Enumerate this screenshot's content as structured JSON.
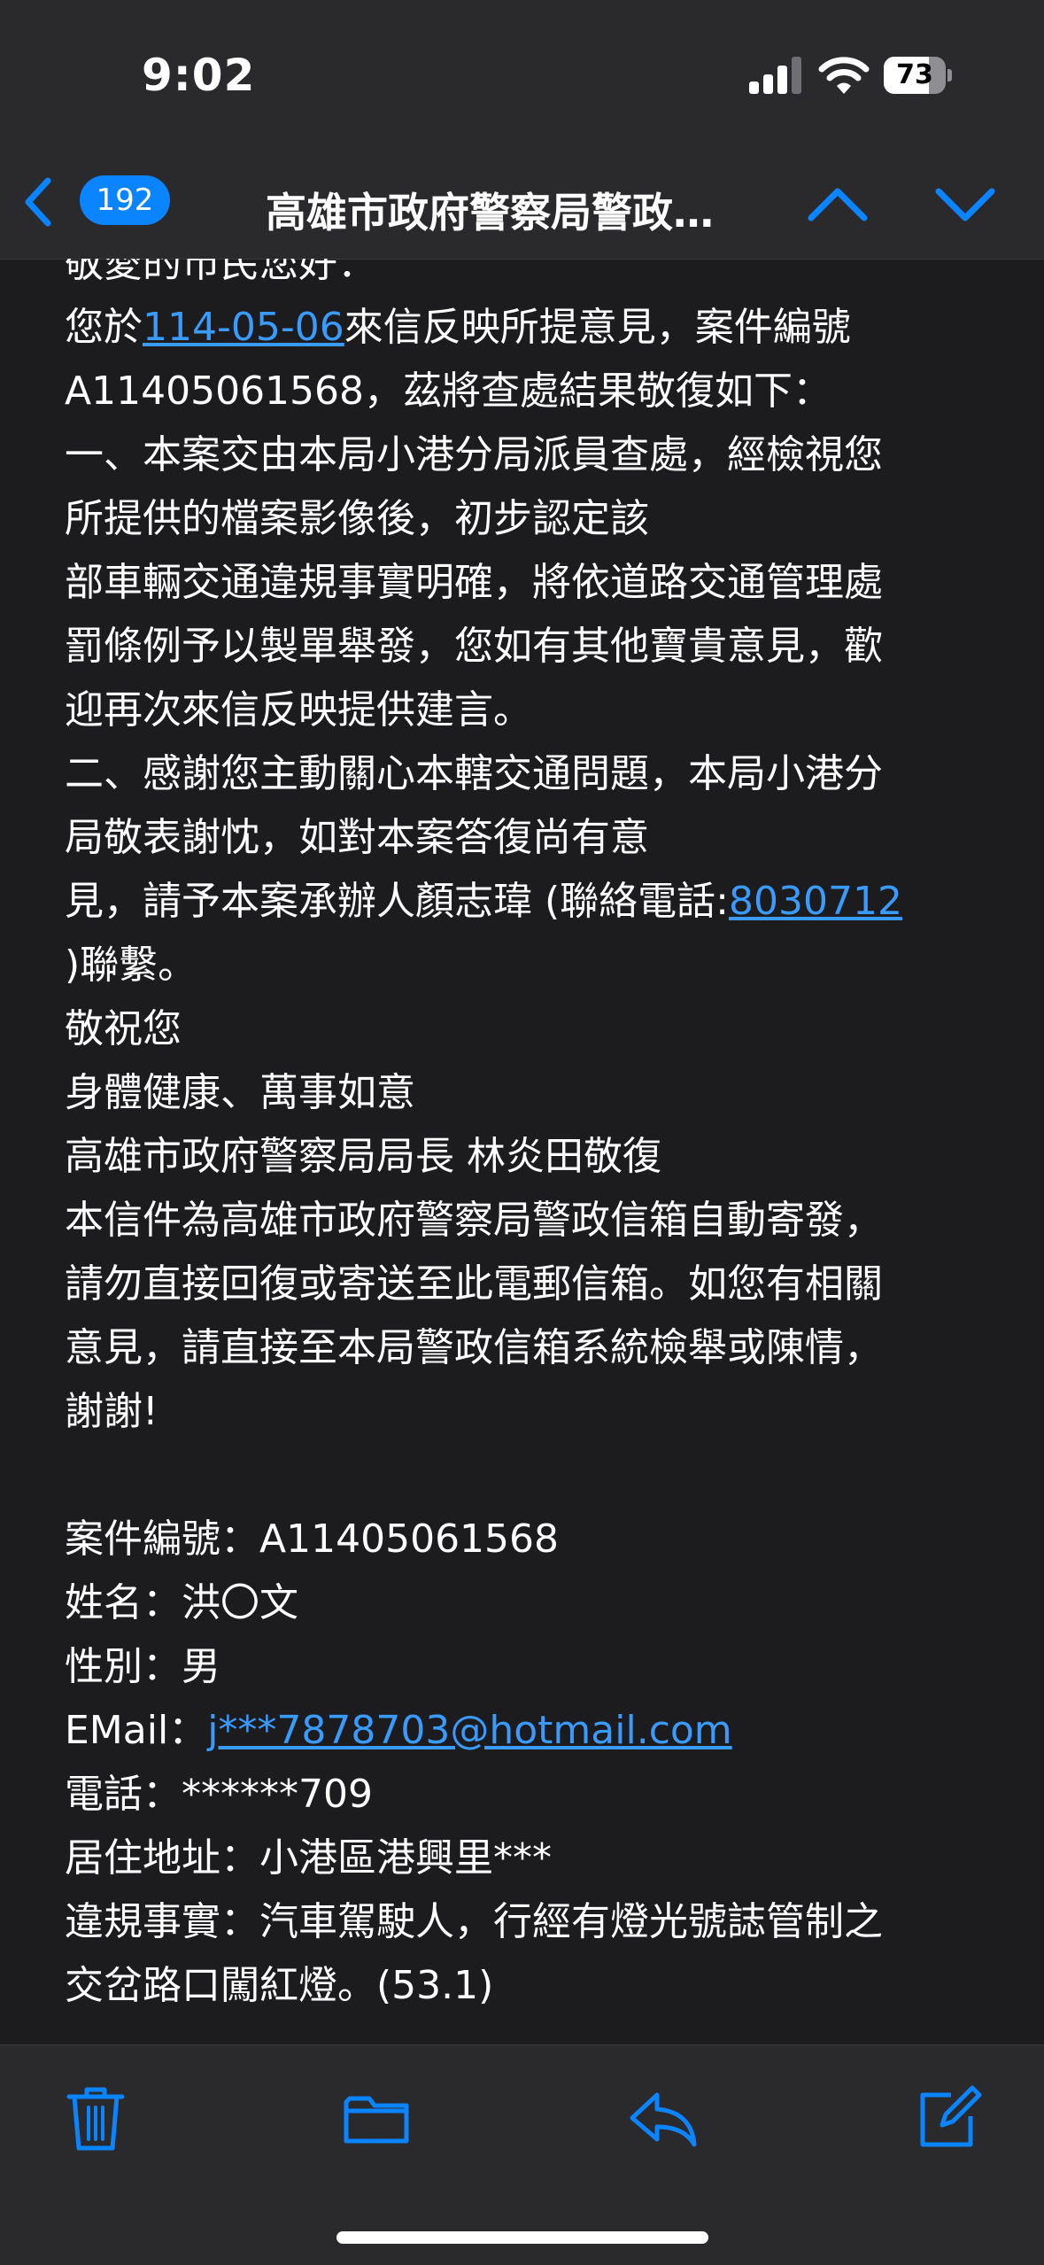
{
  "status_bar": {
    "time": "9:02",
    "battery_level": "73",
    "battery_fraction": 0.73
  },
  "nav": {
    "unread_count": "192",
    "title": "高雄市政府警察局警政…"
  },
  "mail": {
    "greeting": "敬愛的市民您好：",
    "p1_prefix": "您於",
    "p1_date": "114-05-06",
    "p1_suffix": "來信反映所提意見，案件編號",
    "p1_line2": "A11405061568，茲將查處結果敬復如下：",
    "s1_l1": "一、本案交由本局小港分局派員查處，經檢視您",
    "s1_l2": "所提供的檔案影像後，初步認定該",
    "s1_l3": "部車輛交通違規事實明確，將依道路交通管理處",
    "s1_l4": "罰條例予以製單舉發，您如有其他寶貴意見，歡",
    "s1_l5": "迎再次來信反映提供建言。",
    "s2_l1": "二、感謝您主動關心本轄交通問題，本局小港分",
    "s2_l2": "局敬表謝忱，如對本案答復尚有意",
    "s2_l3_prefix": "見，請予本案承辦人顏志瑋 (聯絡電話:",
    "s2_phone": "8030712",
    "s2_l4": ")聯繫。",
    "closing1": "敬祝您",
    "closing2": "身體健康、萬事如意",
    "signature": "高雄市政府警察局局長 林炎田敬復",
    "notice_l1": "本信件為高雄市政府警察局警政信箱自動寄發，",
    "notice_l2": "請勿直接回復或寄送至此電郵信箱。如您有相關",
    "notice_l3": "意見，請直接至本局警政信箱系統檢舉或陳情，",
    "notice_l4": "謝謝!",
    "case_no": "案件編號：A11405061568",
    "name": "姓名：洪〇文",
    "gender": "性別：男",
    "email_label": "EMail：",
    "email_value": "j***7878703@hotmail.com",
    "phone": "電話：******709",
    "address": "居住地址：小港區港興里***",
    "violation_l1": "違規事實：汽車駕駛人，行經有燈光號誌管制之",
    "violation_l2": "交岔路口闖紅燈。(53.1)"
  },
  "toolbar": {
    "icons": [
      "trash-icon",
      "folder-icon",
      "reply-icon",
      "compose-icon"
    ]
  },
  "colors": {
    "accent": "#0a84ff",
    "link": "#3a9bff",
    "background": "#1c1c1e",
    "bar": "#2a2a2c"
  }
}
